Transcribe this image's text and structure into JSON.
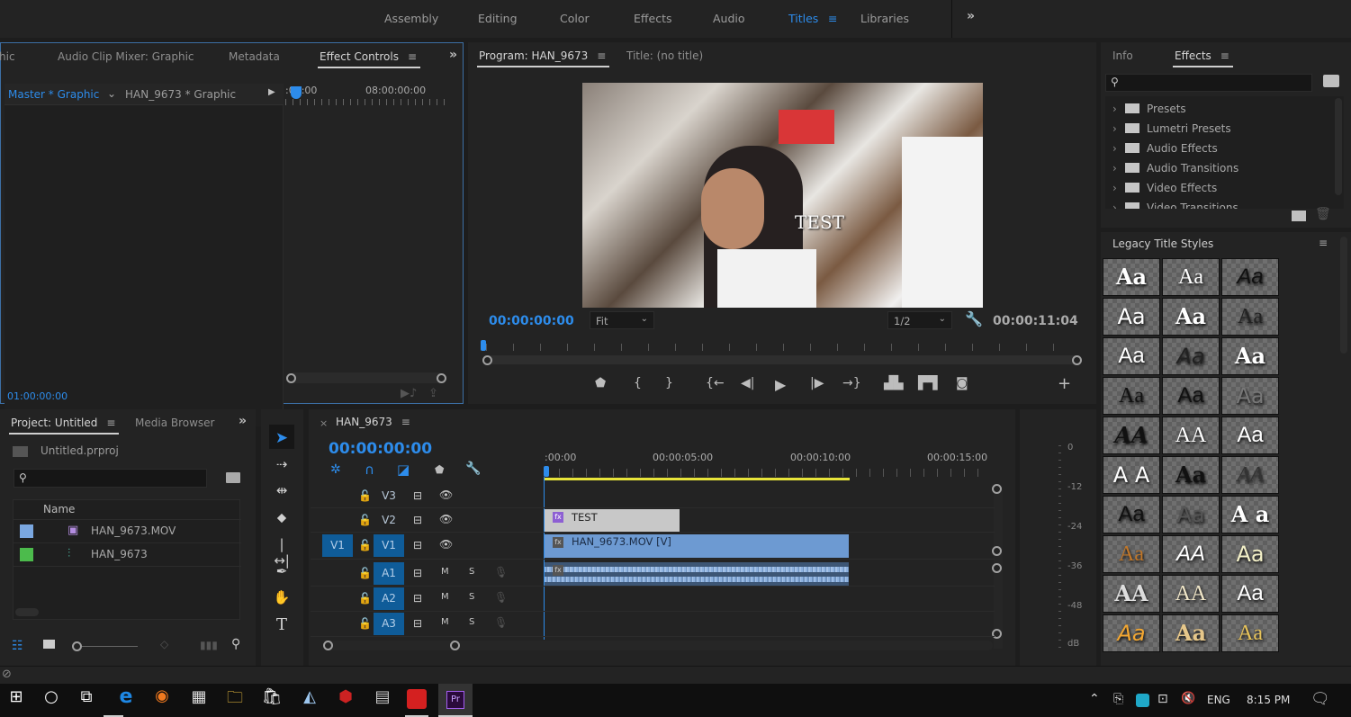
{
  "workspaces": {
    "items": [
      "Assembly",
      "Editing",
      "Color",
      "Effects",
      "Audio",
      "Titles",
      "Libraries"
    ],
    "active": "Titles",
    "more_icon": "double-chevron-right"
  },
  "source_panel": {
    "tabs": [
      "hic",
      "Audio Clip Mixer: Graphic",
      "Metadata",
      "Effect Controls"
    ],
    "active_tab": "Effect Controls",
    "master_label": "Master * Graphic",
    "clip_label": "HAN_9673 * Graphic",
    "ruler_start": ":00:00",
    "ruler_end": "08:00:00:00",
    "timecode": "01:00:00:00"
  },
  "program_monitor": {
    "tabs": [
      "Program: HAN_9673",
      "Title: (no title)"
    ],
    "active_tab": "Program: HAN_9673",
    "overlay_text": "TEST",
    "current_time": "00:00:00:00",
    "zoom_select": "Fit",
    "resolution_select": "1/2",
    "duration": "00:00:11:04",
    "controls": [
      "marker",
      "mark-in",
      "mark-out",
      "go-to-in",
      "step-back",
      "play",
      "step-forward",
      "go-to-out",
      "lift",
      "extract",
      "export-frame",
      "add-button"
    ]
  },
  "effects_panel": {
    "tabs": [
      "Info",
      "Effects"
    ],
    "active_tab": "Effects",
    "search_placeholder": "",
    "tree": [
      "Presets",
      "Lumetri Presets",
      "Audio Effects",
      "Audio Transitions",
      "Video Effects",
      "Video Transitions"
    ]
  },
  "title_styles": {
    "title": "Legacy Title Styles",
    "samples": [
      "Aa",
      "Aa",
      "Aa",
      "Aa",
      "Aa",
      "Aa",
      "Aa",
      "Aa",
      "Aa",
      "Aa",
      "Aa",
      "Aa",
      "AA",
      "AA",
      "Aa",
      "A A",
      "Aa",
      "AA",
      "Aa",
      "Aa",
      "A a",
      "Aa",
      "AA",
      "Aa",
      "AA",
      "AA",
      "Aa",
      "Aa",
      "Aa",
      "Aa"
    ]
  },
  "project_panel": {
    "tabs": [
      "Project: Untitled",
      "Media Browser"
    ],
    "active_tab": "Project: Untitled",
    "project_file": "Untitled.prproj",
    "search_placeholder": "",
    "column_name": "Name",
    "items": [
      {
        "name": "HAN_9673.MOV",
        "label_color": "#7aa7e0",
        "type": "video-clip"
      },
      {
        "name": "HAN_9673",
        "label_color": "#4cbb4c",
        "type": "sequence"
      }
    ]
  },
  "timeline": {
    "sequence_tab": "HAN_9673",
    "timecode": "00:00:00:00",
    "ruler_labels": [
      ":00:00",
      "00:00:05:00",
      "00:00:10:00",
      "00:00:15:00"
    ],
    "video_tracks": [
      {
        "name": "V3",
        "source": ""
      },
      {
        "name": "V2",
        "source": ""
      },
      {
        "name": "V1",
        "source": "V1"
      }
    ],
    "audio_tracks": [
      {
        "name": "A1",
        "mute": "M",
        "solo": "S"
      },
      {
        "name": "A2",
        "mute": "M",
        "solo": "S"
      },
      {
        "name": "A3",
        "mute": "M",
        "solo": "S"
      }
    ],
    "clips": {
      "title_clip": "TEST",
      "video_clip": "HAN_9673.MOV [V]"
    }
  },
  "audio_meter": {
    "labels": [
      "0",
      "-12",
      "-24",
      "-36",
      "-48",
      "dB"
    ]
  },
  "taskbar": {
    "tray": {
      "language": "ENG",
      "time": "8:15 PM"
    }
  }
}
